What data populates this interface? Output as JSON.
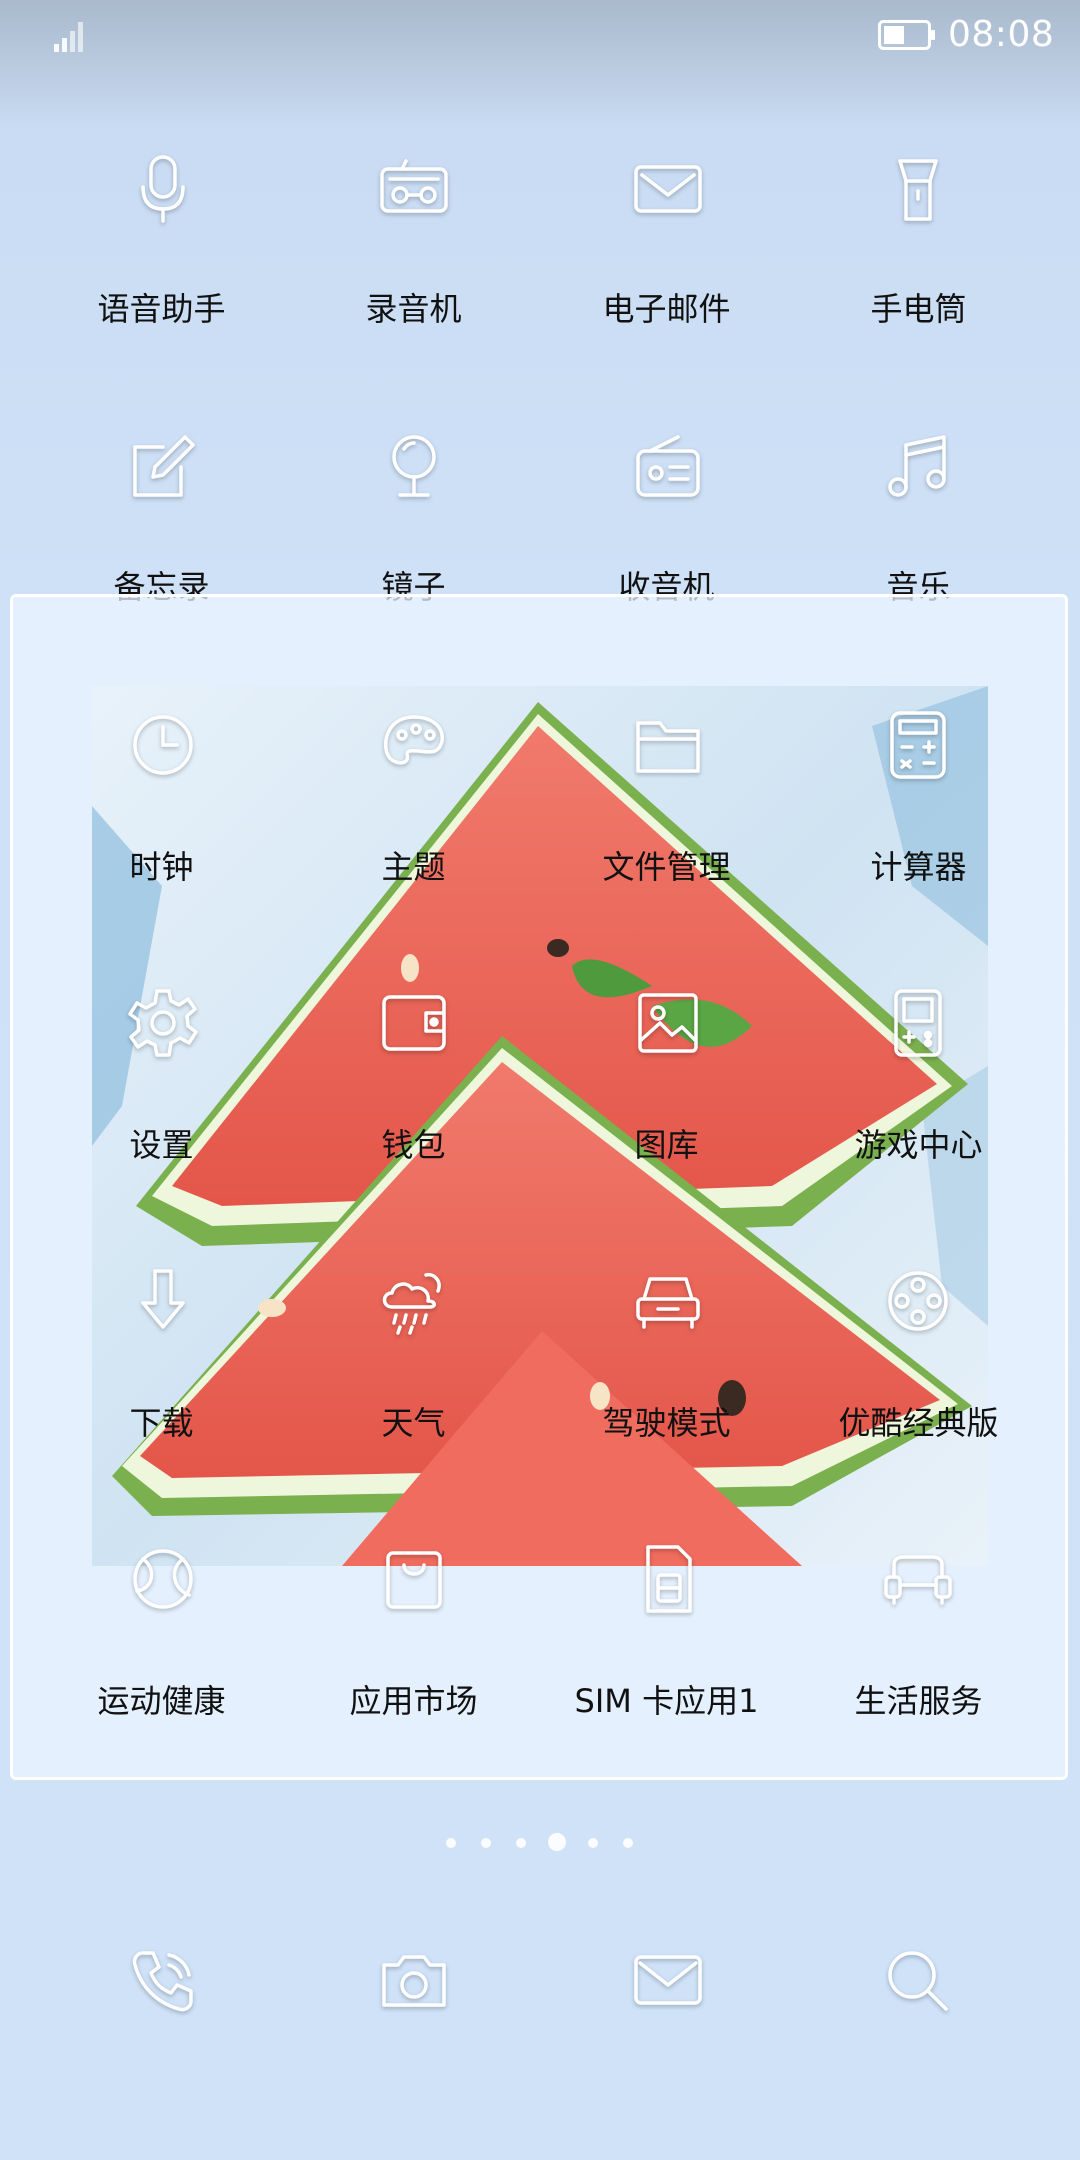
{
  "status_bar": {
    "time": "08:08"
  },
  "home_rows": [
    [
      {
        "label": "语音助手",
        "icon": "microphone-icon"
      },
      {
        "label": "录音机",
        "icon": "recorder-icon"
      },
      {
        "label": "电子邮件",
        "icon": "email-icon"
      },
      {
        "label": "手电筒",
        "icon": "flashlight-icon"
      }
    ],
    [
      {
        "label": "备忘录",
        "icon": "notepad-icon"
      },
      {
        "label": "镜子",
        "icon": "mirror-icon"
      },
      {
        "label": "收音机",
        "icon": "radio-icon"
      },
      {
        "label": "音乐",
        "icon": "music-icon"
      }
    ]
  ],
  "folder_rows": [
    [
      {
        "label": "时钟",
        "icon": "clock-icon"
      },
      {
        "label": "主题",
        "icon": "palette-icon"
      },
      {
        "label": "文件管理",
        "icon": "folder-icon"
      },
      {
        "label": "计算器",
        "icon": "calculator-icon"
      }
    ],
    [
      {
        "label": "设置",
        "icon": "gear-icon"
      },
      {
        "label": "钱包",
        "icon": "wallet-icon"
      },
      {
        "label": "图库",
        "icon": "gallery-icon"
      },
      {
        "label": "游戏中心",
        "icon": "gamepad-icon"
      }
    ],
    [
      {
        "label": "下载",
        "icon": "download-icon"
      },
      {
        "label": "天气",
        "icon": "weather-icon"
      },
      {
        "label": "驾驶模式",
        "icon": "car-icon"
      },
      {
        "label": "优酷经典版",
        "icon": "film-reel-icon"
      }
    ],
    [
      {
        "label": "运动健康",
        "icon": "sports-ball-icon"
      },
      {
        "label": "应用市场",
        "icon": "shopping-bag-icon"
      },
      {
        "label": "SIM 卡应用1",
        "icon": "sim-card-icon"
      },
      {
        "label": "生活服务",
        "icon": "sofa-icon"
      }
    ]
  ],
  "dock": [
    {
      "icon": "phone-icon"
    },
    {
      "icon": "camera-icon"
    },
    {
      "icon": "message-icon"
    },
    {
      "icon": "search-icon"
    }
  ],
  "page_indicator": {
    "pages": 6,
    "current": 4
  }
}
